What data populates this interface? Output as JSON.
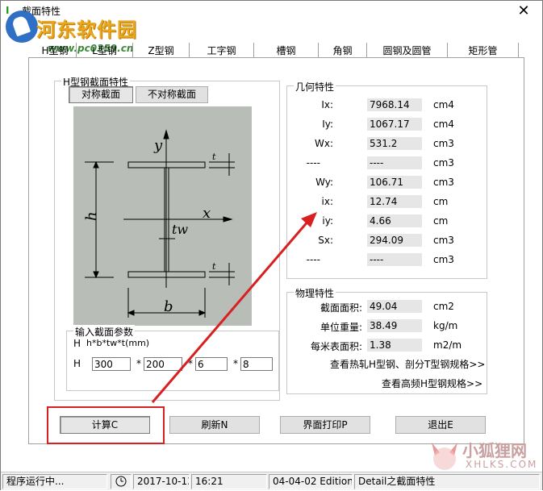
{
  "window": {
    "title": "截面特性",
    "close_glyph": "✕"
  },
  "watermark": {
    "title": "河东软件园",
    "url": "www.pc0359.cn"
  },
  "tabs": [
    {
      "label": "H型钢"
    },
    {
      "label": "L型钢"
    },
    {
      "label": "Z型钢"
    },
    {
      "label": "工字钢"
    },
    {
      "label": "槽钢"
    },
    {
      "label": "角钢"
    },
    {
      "label": "圆钢及圆管"
    },
    {
      "label": "矩形管"
    }
  ],
  "h_section": {
    "group_label": "H型钢截面特性",
    "sym_button": "对称截面",
    "asym_button": "不对称截面",
    "diagram_labels": {
      "y": "y",
      "x": "x",
      "t": "t",
      "tw": "tw",
      "h": "h",
      "b": "b"
    }
  },
  "input_params": {
    "group_label": "输入截面参数",
    "formula_prefix": "H",
    "formula": "h*b*tw*t(mm)",
    "row_label": "H",
    "separator": "*",
    "values": [
      "300",
      "200",
      "6",
      "8"
    ]
  },
  "geometry": {
    "group_label": "几何特性",
    "rows": [
      {
        "name": "Ix:",
        "value": "7968.14",
        "unit": "cm4"
      },
      {
        "name": "Iy:",
        "value": "1067.17",
        "unit": "cm4"
      },
      {
        "name": "Wx:",
        "value": "531.2",
        "unit": "cm3"
      },
      {
        "name": "----",
        "value": "----",
        "unit": "cm3"
      },
      {
        "name": "Wy:",
        "value": "106.71",
        "unit": "cm3"
      },
      {
        "name": "ix:",
        "value": "12.74",
        "unit": "cm"
      },
      {
        "name": "iy:",
        "value": "4.66",
        "unit": "cm"
      },
      {
        "name": "Sx:",
        "value": "294.09",
        "unit": "cm3"
      },
      {
        "name": "----",
        "value": "----",
        "unit": "cm3"
      }
    ]
  },
  "physical": {
    "group_label": "物理特性",
    "rows": [
      {
        "name": "截面面积:",
        "value": "49.04",
        "unit": "cm2"
      },
      {
        "name": "单位重量:",
        "value": "38.49",
        "unit": "kg/m"
      },
      {
        "name": "每米表面积:",
        "value": "1.38",
        "unit": "m2/m"
      }
    ],
    "link1": "查看热轧H型钢、剖分T型钢规格>>",
    "link2": "查看高频H型钢规格>>"
  },
  "actions": {
    "calc": "计算C",
    "refresh": "刷新N",
    "print": "界面打印P",
    "exit": "退出E"
  },
  "status": {
    "running": "程序运行中...",
    "date": "2017-10-13",
    "time": "16:21",
    "edition": "04-04-02 Edition",
    "detail": "Detail之截面特性"
  },
  "corner_watermark": {
    "cn": "小狐狸网",
    "en": "XHLKS.COM"
  },
  "colors": {
    "accent_red": "#d82020",
    "diagram_bg": "#b8bdb8"
  }
}
